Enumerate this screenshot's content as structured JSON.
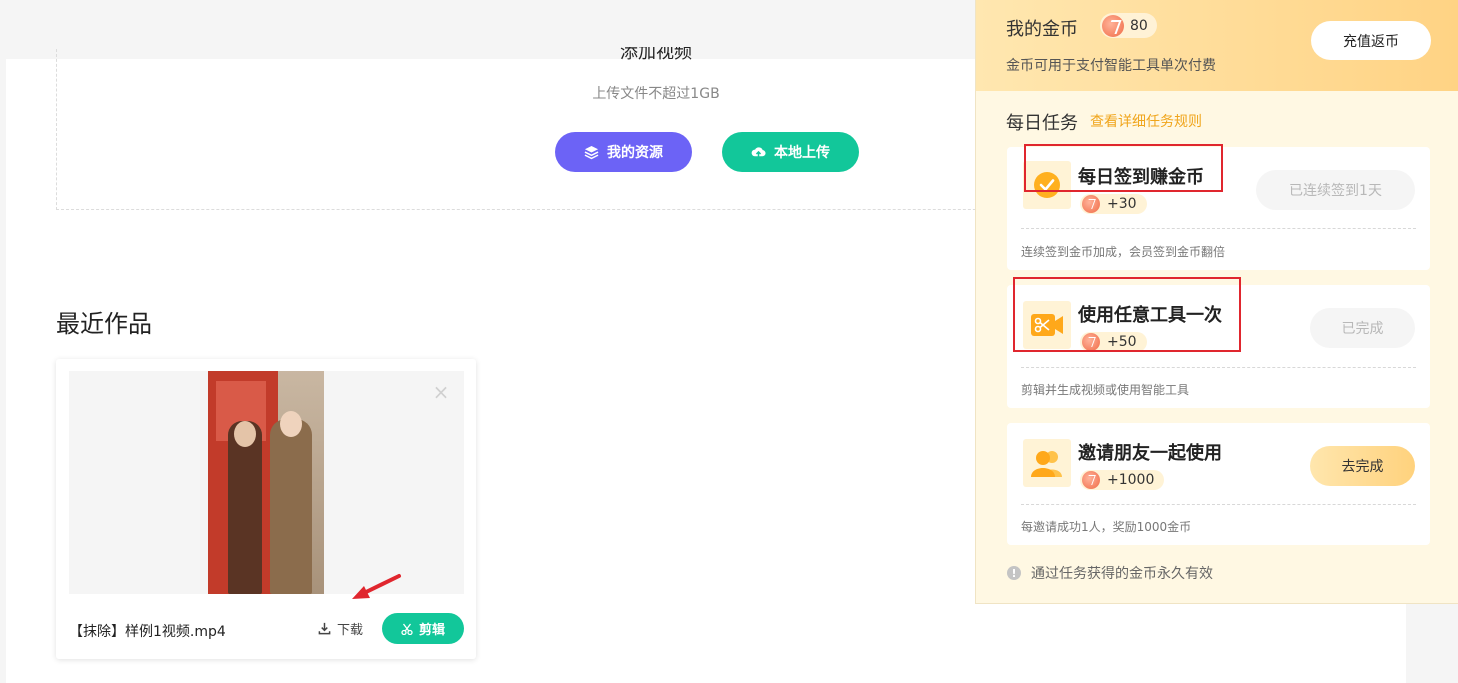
{
  "upload": {
    "title": "添加视频",
    "hint": "上传文件不超过1GB",
    "my_resources": "我的资源",
    "local_upload": "本地上传"
  },
  "recent": {
    "title": "最近作品",
    "items": [
      {
        "name": "【抹除】样例1视频.mp4",
        "download": "下载",
        "edit": "剪辑"
      }
    ]
  },
  "coins": {
    "title": "我的金币",
    "balance": "80",
    "subtitle": "金币可用于支付智能工具单次付费",
    "recharge": "充值返币"
  },
  "daily": {
    "title": "每日任务",
    "rules_link": "查看详细任务规则",
    "tasks": [
      {
        "name": "每日签到赚金币",
        "reward": "+30",
        "button": "已连续签到1天",
        "desc": "连续签到金币加成，会员签到金币翻倍",
        "icon": "check-badge-icon"
      },
      {
        "name": "使用任意工具一次",
        "reward": "+50",
        "button": "已完成",
        "desc": "剪辑并生成视频或使用智能工具",
        "icon": "scissors-camera-icon"
      },
      {
        "name": "邀请朋友一起使用",
        "reward": "+1000",
        "button": "去完成",
        "desc": "每邀请成功1人，奖励1000金币",
        "icon": "friends-icon"
      }
    ],
    "note": "通过任务获得的金币永久有效"
  },
  "colors": {
    "primary_purple": "#6c63f6",
    "primary_green": "#12c79a",
    "accent_orange": "#f0a51b",
    "highlight_red": "#e0262e"
  }
}
